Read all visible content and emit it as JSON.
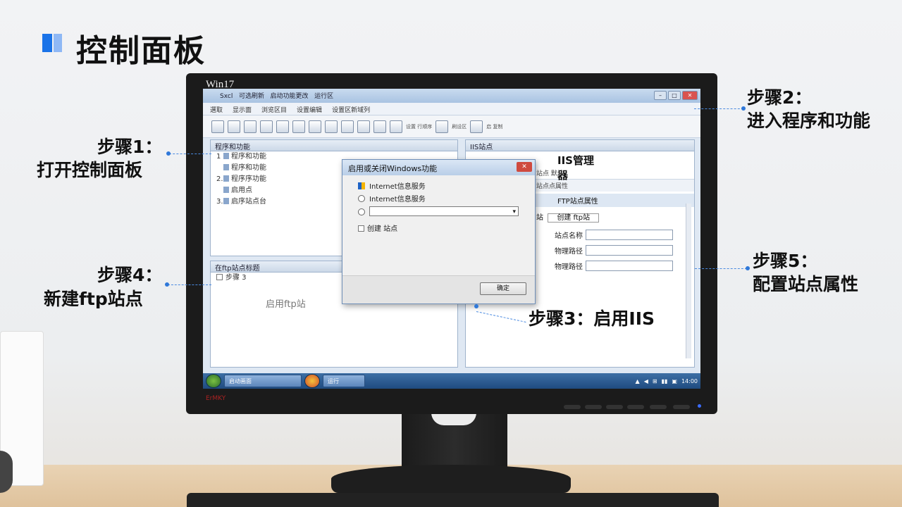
{
  "page_title": "控制面板",
  "monitor": {
    "brand": "Win17",
    "logo": "ErMKY"
  },
  "window": {
    "title_menu": [
      "Sxcl",
      "可选刷新",
      "启动功能更改",
      "运行区"
    ],
    "menubar": [
      "選取",
      "显示面",
      "浏览区目",
      "设置编辑",
      "设置区新域列"
    ],
    "toolbar_groups": [
      "设置 行顺序",
      "刷设区",
      "启 复制"
    ]
  },
  "left_pane": {
    "header": "程序和功能",
    "items": [
      {
        "num": "1",
        "label": "程序和功能"
      },
      {
        "num": "",
        "label": "程序和功能"
      },
      {
        "num": "2.",
        "label": "程序序功能"
      },
      {
        "num": "",
        "label": "启用点"
      },
      {
        "num": "3.",
        "label": "启序站点台"
      }
    ]
  },
  "bottom_left_pane": {
    "header": "在ftp站点标题",
    "checkbox_label": "步骤 3",
    "center_text": "启用ftp站"
  },
  "dialog": {
    "title": "启用或关闭Windows功能",
    "close": "✕",
    "rows": [
      "Internet信息服务",
      "Internet信息服务",
      "",
      "创建 站点"
    ],
    "button": "确定"
  },
  "right_pane": {
    "header": "IIS站点",
    "title": "IIS管理器",
    "sub1": "站点 默认",
    "sub2": "站点点属性",
    "prop_label": "FTP站点属性",
    "create_label": "站",
    "create_value": "创建 ftp站",
    "fields": [
      "站点名称",
      "物理路径",
      "物理路径"
    ]
  },
  "taskbar": {
    "items": [
      "启动画面",
      "运行"
    ],
    "tray": [
      "▲",
      "◀",
      "⊞",
      "▮▮",
      "▣",
      "14:00"
    ]
  },
  "steps": {
    "s1_a": "步骤1：",
    "s1_b": "打开控制面板",
    "s2_a": "步骤2：",
    "s2_b": "进入程序和功能",
    "s3": "步骤3：启用IIS",
    "s4_a": "步骤4：",
    "s4_b": "新建ftp站点",
    "s5_a": "步骤5：",
    "s5_b": "配置站点属性"
  },
  "colors": {
    "accent": "#1a73e8",
    "connector": "#4a8ae0",
    "close_red": "#cf4a3f"
  }
}
